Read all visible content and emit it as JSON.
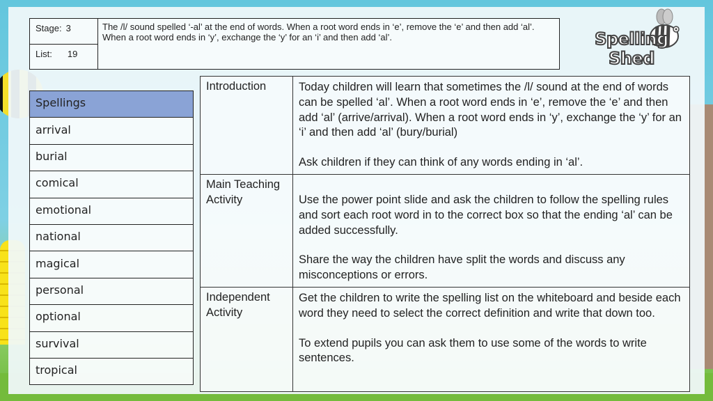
{
  "header": {
    "stage_label": "Stage:",
    "stage_value": "3",
    "list_label": "List:",
    "list_value": "19",
    "rule_text": "The /l/ sound spelled ‘-al’ at the end of words. When a root word ends in ‘e’, remove the ‘e’ and then add ‘al’. When a root word ends in ‘y’, exchange the ‘y’ for an ‘i’ and then add ‘al’."
  },
  "logo": {
    "text": "Spelling Shed",
    "icon": "bee-icon"
  },
  "spellings": {
    "header": "Spellings",
    "words": [
      "arrival",
      "burial",
      "comical",
      "emotional",
      "national",
      "magical",
      "personal",
      "optional",
      "survival",
      "tropical"
    ]
  },
  "lesson": {
    "rows": [
      {
        "label": "Introduction",
        "paragraphs": [
          "Today children will learn that sometimes the /l/ sound at the end of words can be spelled ‘al’.  When a root word ends in ‘e’, remove the ‘e’ and then add ‘al’ (arrive/arrival).  When a root word ends in ‘y’, exchange the ‘y’ for an ‘i’ and then add ‘al’ (bury/burial)",
          "Ask children if they can think of any words ending in ‘al’."
        ]
      },
      {
        "label": "Main Teaching Activity",
        "paragraphs": [
          "Use the power point slide and ask the children to follow the spelling rules and sort each root word in to the correct box so that the ending ‘al’ can be added successfully.",
          "Share the way the children have split the words and discuss any misconceptions or errors."
        ]
      },
      {
        "label": "Independent Activity",
        "paragraphs": [
          "Get the children to write the spelling list on the whiteboard and beside each word they need to select the correct definition and write that down too.",
          "To extend pupils you can ask them to use some of the words to write sentences."
        ]
      }
    ]
  },
  "colors": {
    "spellings_header_bg": "#8aa3d6",
    "sky": "#63c6dd",
    "grass": "#74bb3c"
  }
}
